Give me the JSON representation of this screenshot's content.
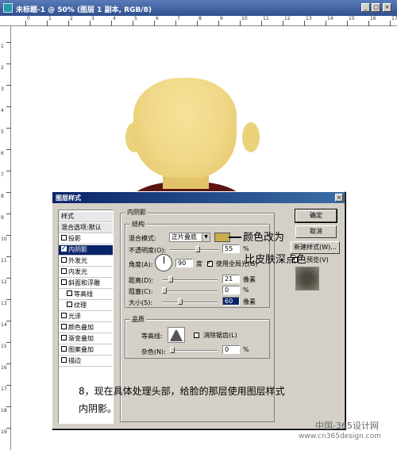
{
  "window": {
    "title": "未标题-1 @ 50% (图层 1 副本, RGB/8)",
    "buttons": [
      "_",
      "□",
      "×"
    ]
  },
  "ruler": {
    "top_labels": [
      "0",
      "1",
      "2",
      "3",
      "4",
      "5",
      "6",
      "7",
      "8",
      "9",
      "10",
      "11",
      "12",
      "13",
      "14",
      "15",
      "16",
      "17"
    ],
    "left_labels": [
      "1",
      "2",
      "3",
      "4",
      "5",
      "6",
      "7",
      "8",
      "9",
      "10",
      "11",
      "12",
      "13",
      "14",
      "15",
      "16",
      "17",
      "18",
      "19"
    ]
  },
  "dialog": {
    "title": "图层样式",
    "close": "×",
    "style_list": [
      {
        "label": "样式",
        "type": "header"
      },
      {
        "label": "混合选项:默认",
        "type": "header"
      },
      {
        "label": "投影",
        "checked": false
      },
      {
        "label": "内阴影",
        "checked": true,
        "selected": true
      },
      {
        "label": "外发光",
        "checked": false
      },
      {
        "label": "内发光",
        "checked": false
      },
      {
        "label": "斜面和浮雕",
        "checked": false
      },
      {
        "label": "等高线",
        "checked": false,
        "indent": true
      },
      {
        "label": "纹理",
        "checked": false,
        "indent": true
      },
      {
        "label": "光泽",
        "checked": false
      },
      {
        "label": "颜色叠加",
        "checked": false
      },
      {
        "label": "渐变叠加",
        "checked": false
      },
      {
        "label": "图案叠加",
        "checked": false
      },
      {
        "label": "描边",
        "checked": false
      }
    ],
    "panel_title": "内阴影",
    "structure_title": "结构",
    "blend_mode_label": "混合模式:",
    "blend_mode_value": "正片叠底",
    "opacity_label": "不透明度(O):",
    "opacity_value": "55",
    "angle_label": "角度(A):",
    "angle_value": "90",
    "angle_unit": "度",
    "global_light_label": "使用全局光(G)",
    "global_light_checked": true,
    "distance_label": "距离(D):",
    "distance_value": "21",
    "choke_label": "阻塞(C):",
    "choke_value": "0",
    "size_label": "大小(S):",
    "size_value": "60",
    "pixel_unit": "像素",
    "percent_unit": "%",
    "quality_title": "品质",
    "contour_label": "等高线:",
    "antialias_label": "消除锯齿(L)",
    "noise_label": "杂色(N):",
    "noise_value": "0",
    "ok_button": "确定",
    "cancel_button": "取消",
    "new_style_button": "新建样式(W)...",
    "preview_label": "预览(V)",
    "swatch_color": "#c8ad4d"
  },
  "annotations": {
    "line1": "颜色改为",
    "line2": "比皮肤深点色"
  },
  "instruction": {
    "line1": "8，现在具体处理头部，给脸的那层使用图层样式",
    "line2": "内阴影。"
  },
  "watermark": {
    "line1": "中国-365设计网",
    "line2": "www.cn365design.com"
  }
}
